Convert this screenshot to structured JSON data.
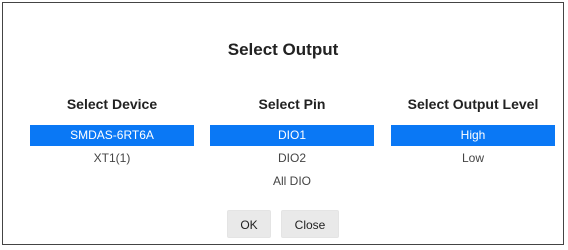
{
  "dialog": {
    "title": "Select Output"
  },
  "columns": {
    "device": {
      "header": "Select Device",
      "options": [
        "SMDAS-6RT6A",
        "XT1(1)"
      ],
      "selected_index": 0
    },
    "pin": {
      "header": "Select Pin",
      "options": [
        "DIO1",
        "DIO2",
        "All DIO"
      ],
      "selected_index": 0
    },
    "level": {
      "header": "Select Output Level",
      "options": [
        "High",
        "Low"
      ],
      "selected_index": 0
    }
  },
  "buttons": {
    "ok_label": "OK",
    "close_label": "Close"
  },
  "colors": {
    "selection": "#0a78f5",
    "selection_text": "#ffffff",
    "border": "#444444"
  }
}
